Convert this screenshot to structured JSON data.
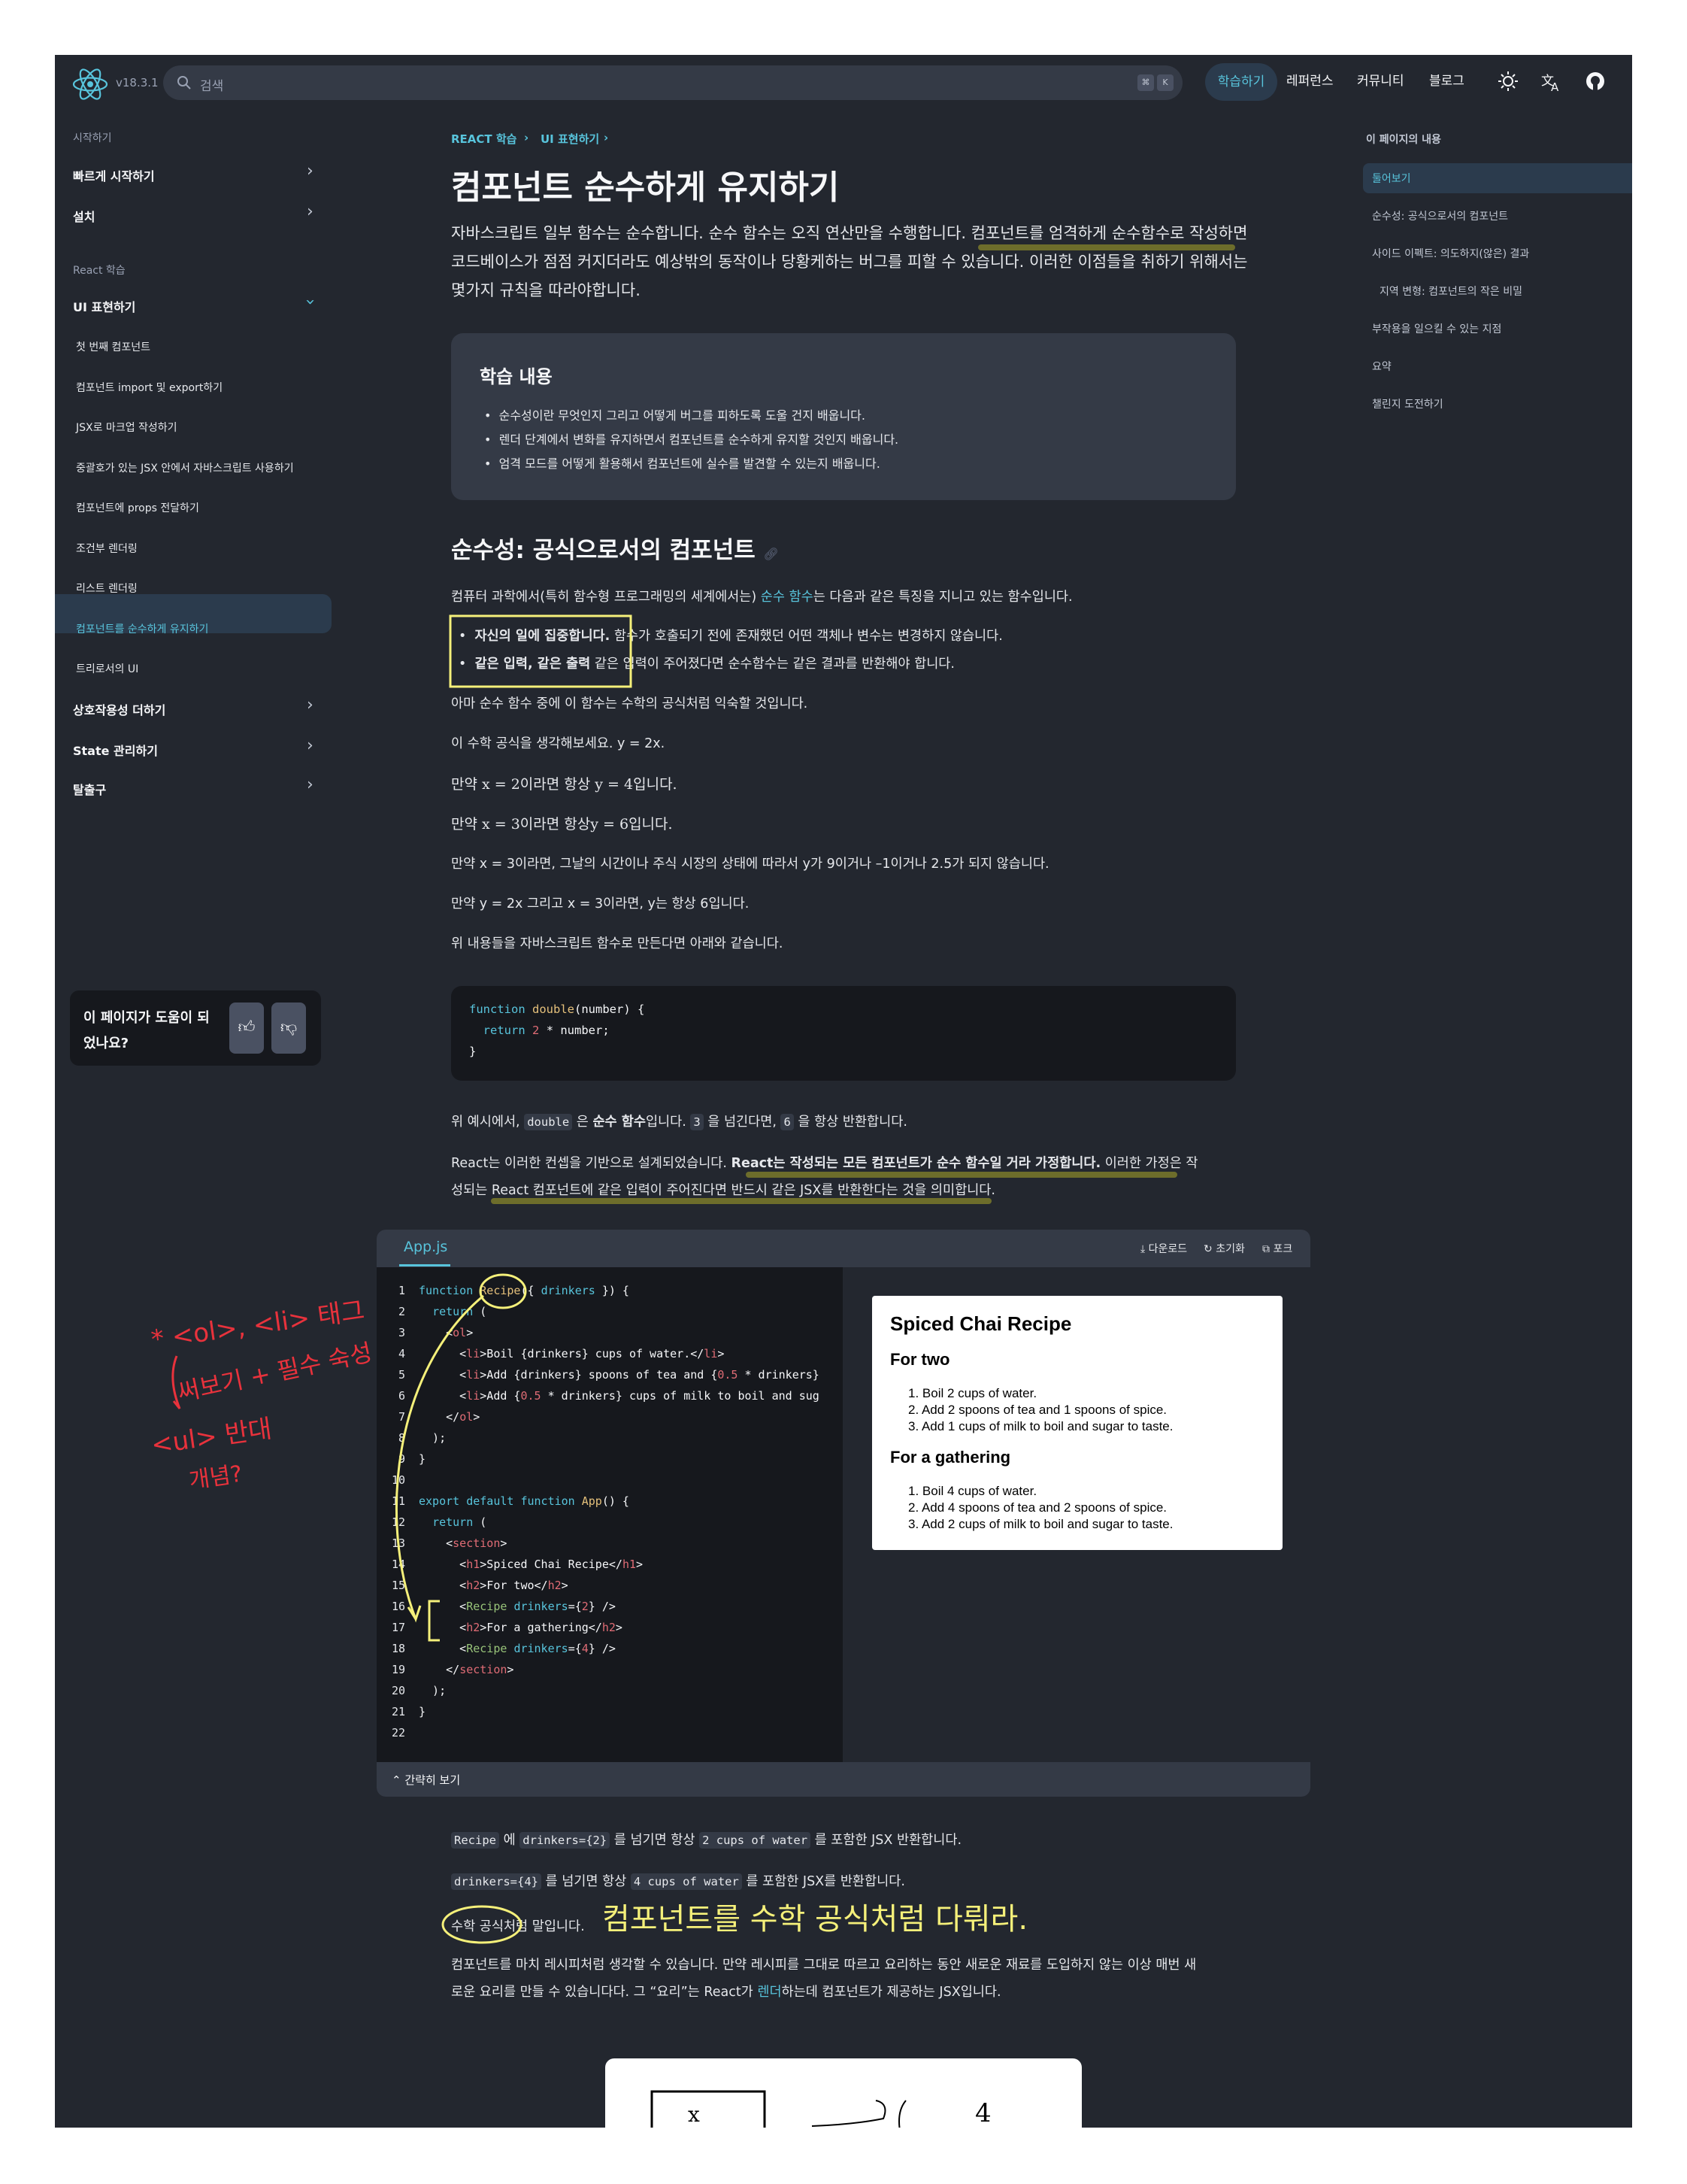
{
  "header": {
    "version": "v18.3.1",
    "search_placeholder": "검색",
    "kbd1": "⌘",
    "kbd2": "K",
    "nav": [
      "학습하기",
      "레퍼런스",
      "커뮤니티",
      "블로그"
    ]
  },
  "sidebar": {
    "section1": "시작하기",
    "quickstart": "빠르게 시작하기",
    "install": "설치",
    "section2": "React 학습",
    "ui": "UI 표현하기",
    "items": [
      "첫 번째 컴포넌트",
      "컴포넌트 import 및 export하기",
      "JSX로 마크업 작성하기",
      "중괄호가 있는 JSX 안에서 자바스크립트 사용하기",
      "컴포넌트에 props 전달하기",
      "조건부 렌더링",
      "리스트 렌더링",
      "컴포넌트를 순수하게 유지하기",
      "트리로서의 UI"
    ],
    "more": [
      "상호작용성 더하기",
      "State 관리하기",
      "탈출구"
    ],
    "feedback": "이 페이지가 도움이 되었나요?"
  },
  "toc": {
    "title": "이 페이지의 내용",
    "items": [
      "둘어보기",
      "순수성: 공식으로서의 컴포넌트",
      "사이드 이펙트: 의도하지(않은) 결과",
      "지역 변형: 컴포넌트의 작은 비밀",
      "부작용을 일으킬 수 있는 지점",
      "요약",
      "챌린지 도전하기"
    ]
  },
  "main": {
    "breadcrumb": [
      "REACT 학습",
      "UI 표현하기"
    ],
    "title": "컴포넌트 순수하게 유지하기",
    "intro": "자바스크립트 일부 함수는 순수합니다. 순수 함수는 오직 연산만을 수행합니다. 컴포넌트를 엄격하게 순수함수로 작성하면 코드베이스가 점점 커지더라도 예상밖의 동작이나 당황케하는 버그를 피할 수 있습니다. 이러한 이점들을 취하기 위해서는 몇가지 규칙을 따라야합니다.",
    "learn_title": "학습 내용",
    "learn_items": [
      "순수성이란 무엇인지 그리고 어떻게 버그를 피하도록 도울 건지 배웁니다.",
      "렌더 단계에서 변화를 유지하면서 컴포넌트를 순수하게 유지할 것인지 배웁니다.",
      "엄격 모드를 어떻게 활용해서 컴포넌트에 실수를 발견할 수 있는지 배웁니다."
    ],
    "h2": "순수성: 공식으로서의 컴포넌트",
    "p1a": "컴퓨터 과학에서(특히 함수형 프로그래밍의 세계에서는) ",
    "p1link": "순수 함수",
    "p1b": "는 다음과 같은 특징을 지니고 있는 함수입니다.",
    "b1bold": "자신의 일에 집중합니다.",
    "b1": " 함수가 호출되기 전에 존재했던 어떤 객체나 변수는 변경하지 않습니다.",
    "b2bold": "같은 입력, 같은 출력",
    "b2": " 같은 입력이 주어졌다면 순수함수는 같은 결과를 반환해야 합니다.",
    "p2": "아마 순수 함수 중에 이 함수는 수학의 공식처럼 익숙할 것입니다.",
    "p3": "이 수학 공식을 생각해보세요. y = 2x.",
    "p4": "만약 x = 2이라면 항상 y = 4입니다.",
    "p5": "만약 x = 3이라면 항상y = 6입니다.",
    "p6": "만약 x = 3이라면, 그날의 시간이나 주식 시장의 상태에 따라서 y가 9이거나 –1이거나 2.5가 되지 않습니다.",
    "p7": "만약 y = 2x 그리고 x = 3이라면, y는 항상 6입니다.",
    "p8": "위 내용들을 자바스크립트 함수로 만든다면 아래와 같습니다.",
    "code": [
      "function double(number) {",
      "  return 2 * number;",
      "}"
    ],
    "p9a": "위 예시에서, ",
    "p9code1": "double",
    "p9b": " 은 ",
    "p9bold": "순수 함수",
    "p9c": "입니다. ",
    "p9code2": "3",
    "p9d": " 을 넘긴다면, ",
    "p9code3": "6",
    "p9e": " 을 항상 반환합니다.",
    "p10a": "React는 이러한 컨셉을 기반으로 설계되었습니다. ",
    "p10bold": "React는 작성되는 모든 컴포넌트가 순수 함수일 거라 가정합니다.",
    "p10b": " 이러한 가정은 작",
    "p10c": "성되는 React 컴포넌트에 같은 입력이 주어진다면 반드시 같은 JSX를 반환한다는 것을 의미합니다.",
    "p11code1": "Recipe",
    "p11a": " 에 ",
    "p11code2": "drinkers={2}",
    "p11b": " 를 넘기면 항상 ",
    "p11code3": "2 cups of water",
    "p11c": " 를 포함한 JSX 반환합니다.",
    "p12code1": "drinkers={4}",
    "p12a": " 를 넘기면 항상 ",
    "p12code2": "4 cups of water",
    "p12b": " 를 포함한 JSX를 반환합니다.",
    "p13": "수학 공식처럼 말입니다.",
    "p14a": "컴포넌트를 마치 레시피처럼 생각할 수 있습니다. 만약 레시피를 그대로 따르고 요리하는 동안 새로운 재료를 도입하지 않는 이상 매번 새",
    "p14b": "로운 요리를 만들 수 있습니다다. 그 “요리”는 React가 ",
    "p14link": "렌더",
    "p14c": "하는데 컴포넌트가 제공하는 JSX입니다."
  },
  "sandbox": {
    "tab": "App.js",
    "actions": [
      "다운로드",
      "초기화",
      "포크"
    ],
    "collapse": "간략히 보기",
    "lines": [
      "1",
      "2",
      "3",
      "4",
      "5",
      "6",
      "7",
      "8",
      "9",
      "10",
      "11",
      "12",
      "13",
      "14",
      "15",
      "16",
      "17",
      "18",
      "19",
      "20",
      "21",
      "22"
    ],
    "preview": {
      "title": "Spiced Chai Recipe",
      "h2a": "For two",
      "listA": [
        "1. Boil 2 cups of water.",
        "2. Add 2 spoons of tea and 1 spoons of spice.",
        "3. Add 1 cups of milk to boil and sugar to taste."
      ],
      "h2b": "For a gathering",
      "listB": [
        "1. Boil 4 cups of water.",
        "2. Add 4 spoons of tea and 2 spoons of spice.",
        "3. Add 2 cups of milk to boil and sugar to taste."
      ]
    }
  },
  "annotations": {
    "note_left_1": "* <ol>, <li> 태그",
    "note_left_2": "써보기 + 필수 숙성",
    "note_left_3": "<ul> 반대",
    "note_left_4": "개념?",
    "note_bottom": "컴포넌트를 수학 공식처럼 다뤄라.",
    "illus_a": "x",
    "illus_b": "4"
  },
  "colors": {
    "bg": "#23272f",
    "accent": "#58c4dc",
    "annotation_red": "#e8323c",
    "annotation_yellow": "#f5f07a"
  }
}
